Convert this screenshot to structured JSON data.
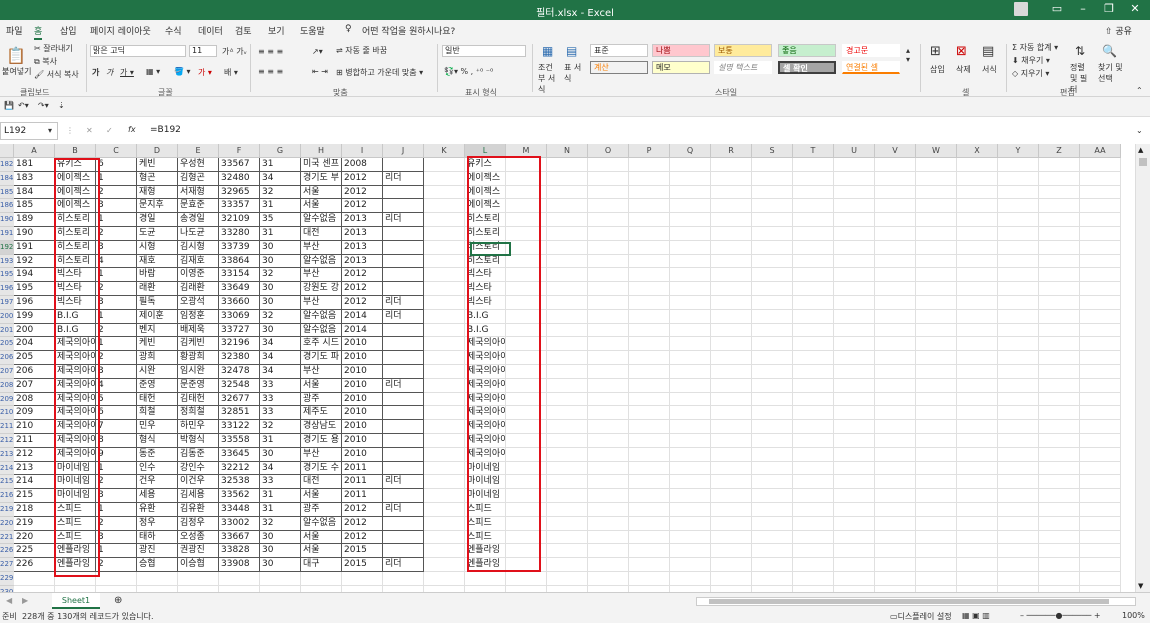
{
  "window": {
    "title": "필터.xlsx  -  Excel"
  },
  "tabs": [
    "파일",
    "홈",
    "삽입",
    "페이지 레이아웃",
    "수식",
    "데이터",
    "검토",
    "보기",
    "도움말"
  ],
  "tell_me": "어떤 작업을 원하시나요?",
  "share": "공유",
  "ribbon": {
    "paste": "붙여넣기",
    "cut": "잘라내기",
    "copy": "복사",
    "format_painter": "서식 복사",
    "font_name": "맑은 고딕",
    "font_size": "11",
    "wrap_text": "자동 줄 바꿈",
    "merge_center": "병합하고 가운데 맞춤",
    "number_format": "일반",
    "conditional_format": "조건부 서식",
    "format_as_table": "표 서식",
    "styles": {
      "normal": "표준",
      "bad": "나쁨",
      "good": "보통",
      "neutral": "좋음",
      "warning": "경고문",
      "calc": "계산",
      "note": "메모",
      "explanatory": "설명 텍스트",
      "check": "셀 확인",
      "linked": "연결된 셀"
    },
    "insert": "삽입",
    "delete": "삭제",
    "format": "서식",
    "autosum": "자동 합계",
    "fill": "채우기",
    "clear": "지우기",
    "sort_filter": "정렬 및 필터",
    "find_select": "찾기 및 선택",
    "groups": {
      "clipboard": "클립보드",
      "font": "글꼴",
      "alignment": "맞춤",
      "number": "표시 형식",
      "styles": "스타일",
      "cells": "셀",
      "editing": "편집"
    }
  },
  "formula": {
    "namebox": "L192",
    "content": "=B192"
  },
  "columns": [
    "A",
    "B",
    "C",
    "D",
    "E",
    "F",
    "G",
    "H",
    "I",
    "J",
    "K",
    "L",
    "M",
    "N",
    "O",
    "P",
    "Q",
    "R",
    "S",
    "T",
    "U",
    "V",
    "W",
    "X",
    "Y",
    "Z",
    "AA"
  ],
  "rows": [
    {
      "r": "182",
      "a": "181",
      "b": "유키스",
      "c": "6",
      "d": "케빈",
      "e": "우성현",
      "f": "33567",
      "g": "31",
      "h": "미국 센프",
      "i": "2008",
      "j": "",
      "l": "유키스"
    },
    {
      "r": "184",
      "a": "183",
      "b": "에이젝스",
      "c": "1",
      "d": "형곤",
      "e": "김형곤",
      "f": "32480",
      "g": "34",
      "h": "경기도 부",
      "i": "2012",
      "j": "리더",
      "l": "에이젝스"
    },
    {
      "r": "185",
      "a": "184",
      "b": "에이젝스",
      "c": "2",
      "d": "재형",
      "e": "서재형",
      "f": "32965",
      "g": "32",
      "h": "서울",
      "i": "2012",
      "j": "",
      "l": "에이젝스"
    },
    {
      "r": "186",
      "a": "185",
      "b": "에이젝스",
      "c": "3",
      "d": "문지후",
      "e": "문효준",
      "f": "33357",
      "g": "31",
      "h": "서울",
      "i": "2012",
      "j": "",
      "l": "에이젝스"
    },
    {
      "r": "190",
      "a": "189",
      "b": "히스토리",
      "c": "1",
      "d": "경일",
      "e": "송경일",
      "f": "32109",
      "g": "35",
      "h": "알수없음",
      "i": "2013",
      "j": "리더",
      "l": "히스토리"
    },
    {
      "r": "191",
      "a": "190",
      "b": "히스토리",
      "c": "2",
      "d": "도균",
      "e": "나도균",
      "f": "33280",
      "g": "31",
      "h": "대전",
      "i": "2013",
      "j": "",
      "l": "히스토리"
    },
    {
      "r": "192",
      "a": "191",
      "b": "히스토리",
      "c": "3",
      "d": "시형",
      "e": "김시형",
      "f": "33739",
      "g": "30",
      "h": "부산",
      "i": "2013",
      "j": "",
      "l": "히스토리"
    },
    {
      "r": "193",
      "a": "192",
      "b": "히스토리",
      "c": "4",
      "d": "재호",
      "e": "김재호",
      "f": "33864",
      "g": "30",
      "h": "알수없음",
      "i": "2013",
      "j": "",
      "l": "히스토리"
    },
    {
      "r": "195",
      "a": "194",
      "b": "빅스타",
      "c": "1",
      "d": "바람",
      "e": "이영준",
      "f": "33154",
      "g": "32",
      "h": "부산",
      "i": "2012",
      "j": "",
      "l": "빅스타"
    },
    {
      "r": "196",
      "a": "195",
      "b": "빅스타",
      "c": "2",
      "d": "래환",
      "e": "김래환",
      "f": "33649",
      "g": "30",
      "h": "강원도 강",
      "i": "2012",
      "j": "",
      "l": "빅스타"
    },
    {
      "r": "197",
      "a": "196",
      "b": "빅스타",
      "c": "3",
      "d": "필독",
      "e": "오광석",
      "f": "33660",
      "g": "30",
      "h": "부산",
      "i": "2012",
      "j": "리더",
      "l": "빅스타"
    },
    {
      "r": "200",
      "a": "199",
      "b": "B.I.G",
      "c": "1",
      "d": "제이훈",
      "e": "임정훈",
      "f": "33069",
      "g": "32",
      "h": "알수없음",
      "i": "2014",
      "j": "리더",
      "l": "B.I.G"
    },
    {
      "r": "201",
      "a": "200",
      "b": "B.I.G",
      "c": "2",
      "d": "벤지",
      "e": "배제욱",
      "f": "33727",
      "g": "30",
      "h": "알수없음",
      "i": "2014",
      "j": "",
      "l": "B.I.G"
    },
    {
      "r": "205",
      "a": "204",
      "b": "제국의아이",
      "c": "1",
      "d": "케빈",
      "e": "김케빈",
      "f": "32196",
      "g": "34",
      "h": "호주 시드",
      "i": "2010",
      "j": "",
      "l": "제국의아이들"
    },
    {
      "r": "206",
      "a": "205",
      "b": "제국의아이",
      "c": "2",
      "d": "광희",
      "e": "황광희",
      "f": "32380",
      "g": "34",
      "h": "경기도 파",
      "i": "2010",
      "j": "",
      "l": "제국의아이들"
    },
    {
      "r": "207",
      "a": "206",
      "b": "제국의아이",
      "c": "3",
      "d": "시완",
      "e": "임시완",
      "f": "32478",
      "g": "34",
      "h": "부산",
      "i": "2010",
      "j": "",
      "l": "제국의아이들"
    },
    {
      "r": "208",
      "a": "207",
      "b": "제국의아이",
      "c": "4",
      "d": "준영",
      "e": "문준영",
      "f": "32548",
      "g": "33",
      "h": "서울",
      "i": "2010",
      "j": "리더",
      "l": "제국의아이들"
    },
    {
      "r": "209",
      "a": "208",
      "b": "제국의아이",
      "c": "5",
      "d": "태헌",
      "e": "김태헌",
      "f": "32677",
      "g": "33",
      "h": "광주",
      "i": "2010",
      "j": "",
      "l": "제국의아이들"
    },
    {
      "r": "210",
      "a": "209",
      "b": "제국의아이",
      "c": "6",
      "d": "희철",
      "e": "정희철",
      "f": "32851",
      "g": "33",
      "h": "제주도",
      "i": "2010",
      "j": "",
      "l": "제국의아이들"
    },
    {
      "r": "211",
      "a": "210",
      "b": "제국의아이",
      "c": "7",
      "d": "민우",
      "e": "하민우",
      "f": "33122",
      "g": "32",
      "h": "경상남도",
      "i": "2010",
      "j": "",
      "l": "제국의아이들"
    },
    {
      "r": "212",
      "a": "211",
      "b": "제국의아이",
      "c": "8",
      "d": "형식",
      "e": "박형식",
      "f": "33558",
      "g": "31",
      "h": "경기도 용",
      "i": "2010",
      "j": "",
      "l": "제국의아이들"
    },
    {
      "r": "213",
      "a": "212",
      "b": "제국의아이",
      "c": "9",
      "d": "동준",
      "e": "김동준",
      "f": "33645",
      "g": "30",
      "h": "부산",
      "i": "2010",
      "j": "",
      "l": "제국의아이들"
    },
    {
      "r": "214",
      "a": "213",
      "b": "마이네임",
      "c": "1",
      "d": "인수",
      "e": "강인수",
      "f": "32212",
      "g": "34",
      "h": "경기도 수",
      "i": "2011",
      "j": "",
      "l": "마이네임"
    },
    {
      "r": "215",
      "a": "214",
      "b": "마이네임",
      "c": "2",
      "d": "건우",
      "e": "이건우",
      "f": "32538",
      "g": "33",
      "h": "대전",
      "i": "2011",
      "j": "리더",
      "l": "마이네임"
    },
    {
      "r": "216",
      "a": "215",
      "b": "마이네임",
      "c": "3",
      "d": "세용",
      "e": "김세용",
      "f": "33562",
      "g": "31",
      "h": "서울",
      "i": "2011",
      "j": "",
      "l": "마이네임"
    },
    {
      "r": "219",
      "a": "218",
      "b": "스피드",
      "c": "1",
      "d": "유환",
      "e": "김유환",
      "f": "33448",
      "g": "31",
      "h": "광주",
      "i": "2012",
      "j": "리더",
      "l": "스피드"
    },
    {
      "r": "220",
      "a": "219",
      "b": "스피드",
      "c": "2",
      "d": "정우",
      "e": "김정우",
      "f": "33002",
      "g": "32",
      "h": "알수없음",
      "i": "2012",
      "j": "",
      "l": "스피드"
    },
    {
      "r": "221",
      "a": "220",
      "b": "스피드",
      "c": "3",
      "d": "태하",
      "e": "오성종",
      "f": "33667",
      "g": "30",
      "h": "서울",
      "i": "2012",
      "j": "",
      "l": "스피드"
    },
    {
      "r": "226",
      "a": "225",
      "b": "엔플라잉",
      "c": "1",
      "d": "광진",
      "e": "권광진",
      "f": "33828",
      "g": "30",
      "h": "서울",
      "i": "2015",
      "j": "",
      "l": "엔플라잉"
    },
    {
      "r": "227",
      "a": "226",
      "b": "엔플라잉",
      "c": "2",
      "d": "승협",
      "e": "이승협",
      "f": "33908",
      "g": "30",
      "h": "대구",
      "i": "2015",
      "j": "리더",
      "l": "엔플라잉"
    },
    {
      "r": "229",
      "a": "",
      "b": "",
      "c": "",
      "d": "",
      "e": "",
      "f": "",
      "g": "",
      "h": "",
      "i": "",
      "j": "",
      "l": ""
    },
    {
      "r": "230",
      "a": "",
      "b": "",
      "c": "",
      "d": "",
      "e": "",
      "f": "",
      "g": "",
      "h": "",
      "i": "",
      "j": "",
      "l": ""
    }
  ],
  "sheet": {
    "name": "Sheet1"
  },
  "status": {
    "left_prefix": "준비",
    "record_text": "228개 중 130개의 레코드가 있습니다.",
    "display_settings": "디스플레이 설정",
    "zoom": "100%"
  }
}
